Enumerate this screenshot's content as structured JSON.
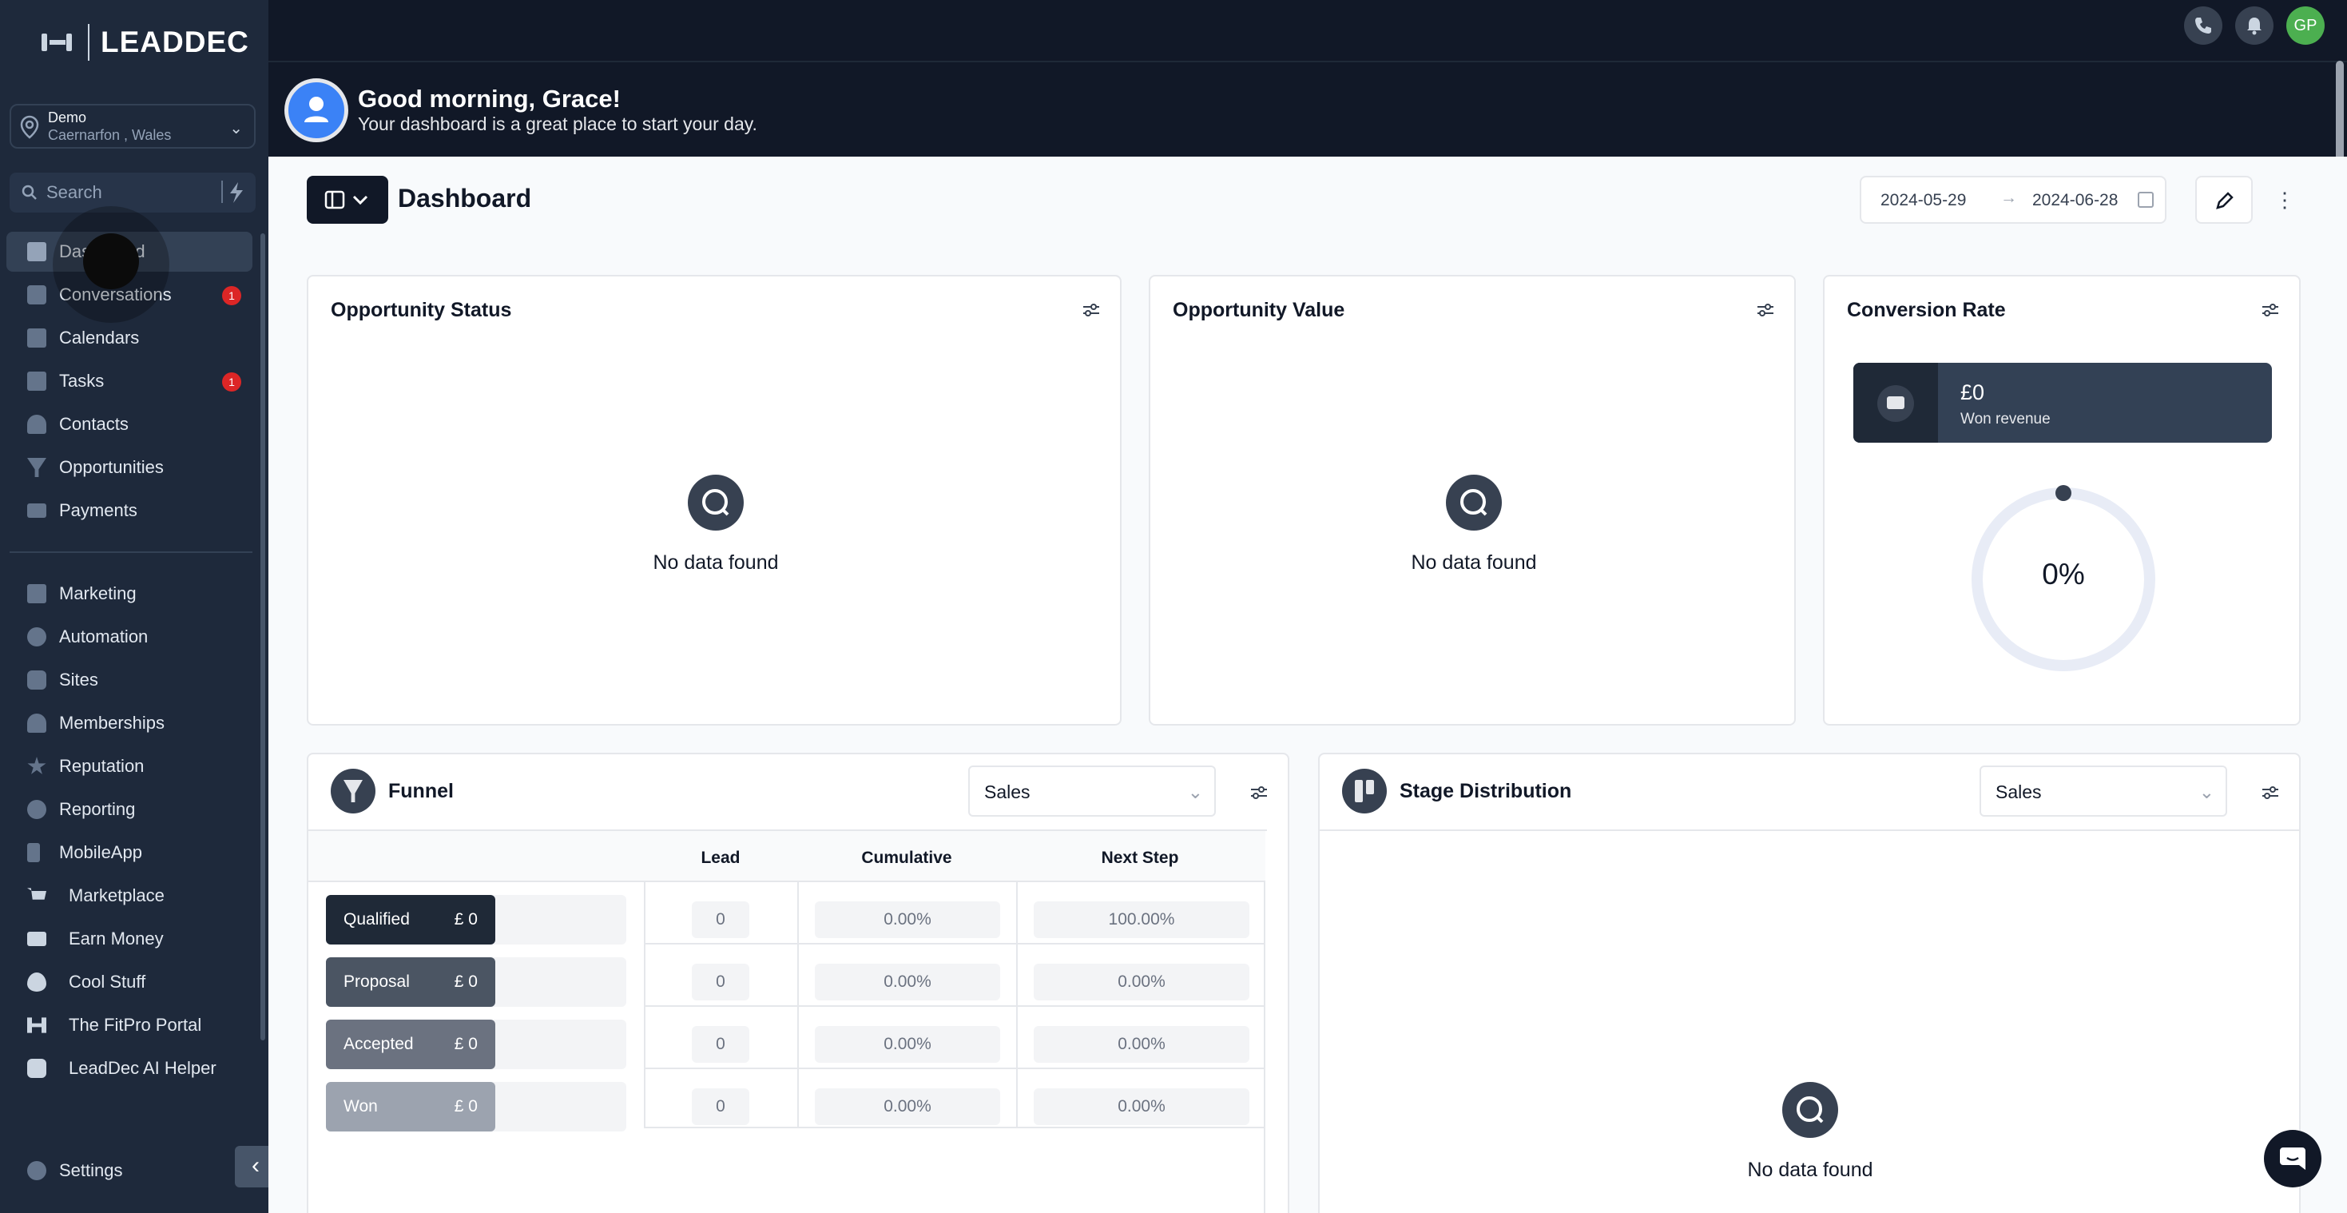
{
  "brand": {
    "name": "LEADDEC"
  },
  "location": {
    "name": "Demo",
    "sub": "Caernarfon , Wales"
  },
  "search": {
    "placeholder": "Search"
  },
  "nav": {
    "primary": [
      {
        "label": "Dashboard",
        "icon": "dashboard-icon",
        "active": true
      },
      {
        "label": "Conversations",
        "icon": "chat-icon",
        "badge": "1"
      },
      {
        "label": "Calendars",
        "icon": "calendar-icon"
      },
      {
        "label": "Tasks",
        "icon": "task-icon",
        "badge": "1"
      },
      {
        "label": "Contacts",
        "icon": "person-icon"
      },
      {
        "label": "Opportunities",
        "icon": "funnel-icon"
      },
      {
        "label": "Payments",
        "icon": "card-icon"
      }
    ],
    "secondary": [
      {
        "label": "Marketing",
        "icon": "megaphone-icon"
      },
      {
        "label": "Automation",
        "icon": "automation-icon"
      },
      {
        "label": "Sites",
        "icon": "sites-icon"
      },
      {
        "label": "Memberships",
        "icon": "members-icon"
      },
      {
        "label": "Reputation",
        "icon": "star-icon"
      },
      {
        "label": "Reporting",
        "icon": "chart-pie-icon"
      },
      {
        "label": "MobileApp",
        "icon": "mobile-icon"
      },
      {
        "label": "Marketplace",
        "icon": "cart-icon"
      },
      {
        "label": "Earn Money",
        "icon": "money-icon"
      },
      {
        "label": "Cool Stuff",
        "icon": "flame-icon"
      },
      {
        "label": "The FitPro Portal",
        "icon": "dumbbell-icon"
      },
      {
        "label": "LeadDec AI Helper",
        "icon": "robot-icon"
      }
    ],
    "settings": "Settings"
  },
  "topbar": {
    "avatar": "GP"
  },
  "greeting": {
    "title": "Good morning, Grace!",
    "subtitle": "Your dashboard is a great place to start your day."
  },
  "dashboard": {
    "title": "Dashboard",
    "date_from": "2024-05-29",
    "date_to": "2024-06-28"
  },
  "cards": {
    "opportunity_status": {
      "title": "Opportunity Status",
      "empty": "No data found"
    },
    "opportunity_value": {
      "title": "Opportunity Value",
      "empty": "No data found"
    },
    "conversion_rate": {
      "title": "Conversion Rate",
      "won_value": "£0",
      "won_label": "Won revenue",
      "percent": "0%"
    }
  },
  "funnel": {
    "title": "Funnel",
    "pipeline": "Sales",
    "columns": [
      "Lead",
      "Cumulative",
      "Next Step"
    ],
    "rows": [
      {
        "stage": "Qualified",
        "amount": "£ 0",
        "lead": "0",
        "cumulative": "0.00%",
        "next": "100.00%",
        "color": "#1f2937"
      },
      {
        "stage": "Proposal",
        "amount": "£ 0",
        "lead": "0",
        "cumulative": "0.00%",
        "next": "0.00%",
        "color": "#4b5563"
      },
      {
        "stage": "Accepted",
        "amount": "£ 0",
        "lead": "0",
        "cumulative": "0.00%",
        "next": "0.00%",
        "color": "#6b7280"
      },
      {
        "stage": "Won",
        "amount": "£ 0",
        "lead": "0",
        "cumulative": "0.00%",
        "next": "0.00%",
        "color": "#9ca3af"
      }
    ]
  },
  "stage_distribution": {
    "title": "Stage Distribution",
    "pipeline": "Sales",
    "empty": "No data found"
  }
}
